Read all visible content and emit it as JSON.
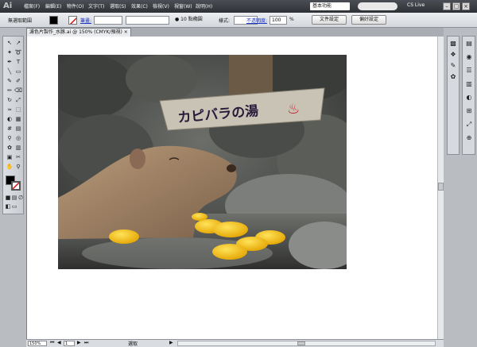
{
  "menubar": {
    "logo": "Ai",
    "items": [
      "檔案(F)",
      "編輯(E)",
      "物件(O)",
      "文字(T)",
      "選取(S)",
      "效果(C)",
      "檢視(V)",
      "視窗(W)",
      "說明(H)"
    ],
    "workspace": "基本功能",
    "cslive": "CS Live"
  },
  "control": {
    "selection_label": "無選取範圍",
    "stroke_label": "筆畫:",
    "brush_size": "10 點橢圓",
    "style_label": "樣式:",
    "opacity_label": "不透明度:",
    "opacity_value": "100",
    "opacity_unit": "%",
    "doc_setup_button": "文件設定",
    "prefs_button": "偏好設定"
  },
  "document": {
    "tab_title": "濾色片製作_水豚.ai @ 150% (CMYK/預視)",
    "zoom": "150%",
    "page": "1",
    "status": "選取"
  },
  "photo": {
    "sign_text": "カピバラの湯",
    "sign_symbol": "♨"
  },
  "colors": {
    "accent": "#1b35c4",
    "fill_swatch": "#000000",
    "stroke_none": "#d11111"
  }
}
